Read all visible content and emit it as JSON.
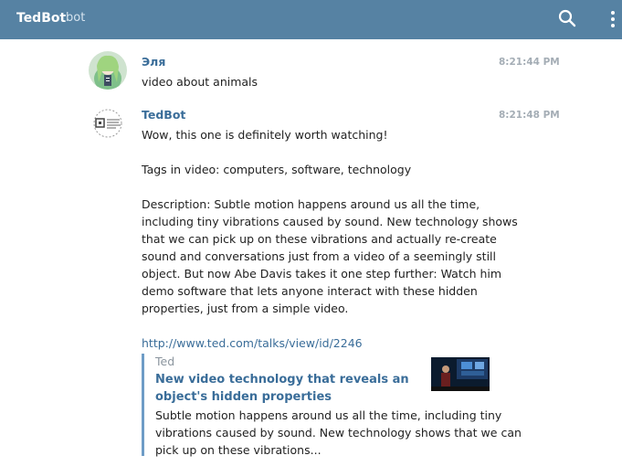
{
  "header": {
    "title": "TedBot",
    "subtitle": "bot",
    "search_icon": "search-icon",
    "menu_icon": "more-vertical-icon",
    "bg_color": "#5682a3"
  },
  "messages": [
    {
      "author": "Эля",
      "time": "8:21:44 PM",
      "avatar_icon": "user-avatar",
      "lines": [
        "video about animals"
      ]
    },
    {
      "author": "TedBot",
      "time": "8:21:48 PM",
      "avatar_icon": "ted-avatar",
      "lines": [
        "Wow, this one is definitely worth watching!",
        "",
        "Tags in video: computers, software, technology",
        "",
        "Description: Subtle motion happens around us all the time,",
        "including tiny vibrations caused by sound. New technology shows",
        "that we can pick up on these vibrations and actually re-create",
        "sound and conversations just from a video of a seemingly still",
        "object. But now Abe Davis takes it one step further: Watch him",
        "demo software that lets anyone interact with these hidden",
        "properties, just from a simple video.",
        ""
      ],
      "link": "http://www.ted.com/talks/view/id/2246"
    }
  ],
  "preview": {
    "site": "Ted",
    "title_lines": [
      "New video technology that reveals an",
      "object's hidden properties"
    ],
    "desc_lines": [
      "Subtle motion happens around us all the time, including tiny",
      "vibrations caused by sound. New technology shows that we can",
      "pick up on these vibrations..."
    ],
    "accent_color": "#6e9cc6"
  }
}
